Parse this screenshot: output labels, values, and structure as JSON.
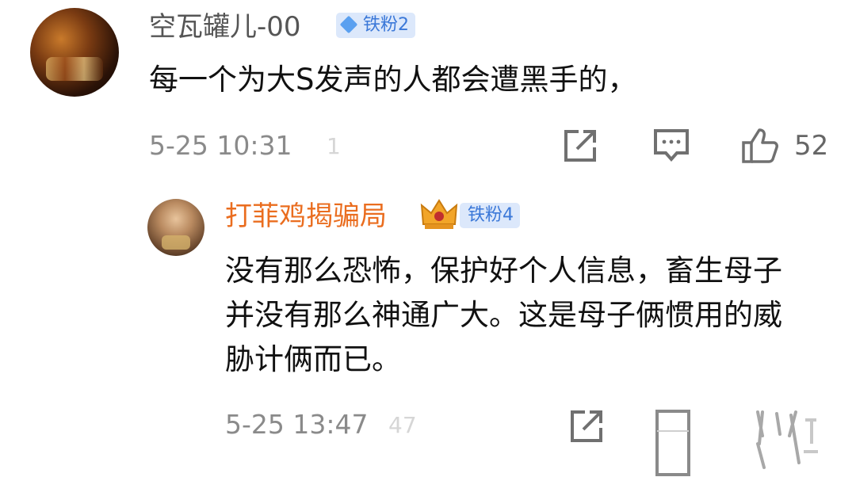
{
  "comments": [
    {
      "username": "空瓦罐儿-00",
      "badge": "铁粉2",
      "text": "每一个为大S发声的人都会遭黑手的，",
      "timestamp": "5-25 10:31",
      "faint": "1",
      "like_count": "52"
    },
    {
      "username": "打菲鸡揭骗局",
      "badge": "铁粉4",
      "text": "没有那么恐怖，保护好个人信息，畜生母子并没有那么神通广大。这是母子俩惯用的威胁计俩而已。",
      "timestamp": "5-25 13:47",
      "faint": "47",
      "like_count": ""
    }
  ],
  "colors": {
    "username_primary": "#555555",
    "username_reply": "#ea6d1f",
    "badge_bg": "#dce8fb",
    "badge_text": "#3b78d8",
    "meta_gray": "#8a8a8a"
  },
  "icons": [
    "share-icon",
    "comment-icon",
    "like-icon",
    "diamond-icon",
    "crown-icon"
  ]
}
